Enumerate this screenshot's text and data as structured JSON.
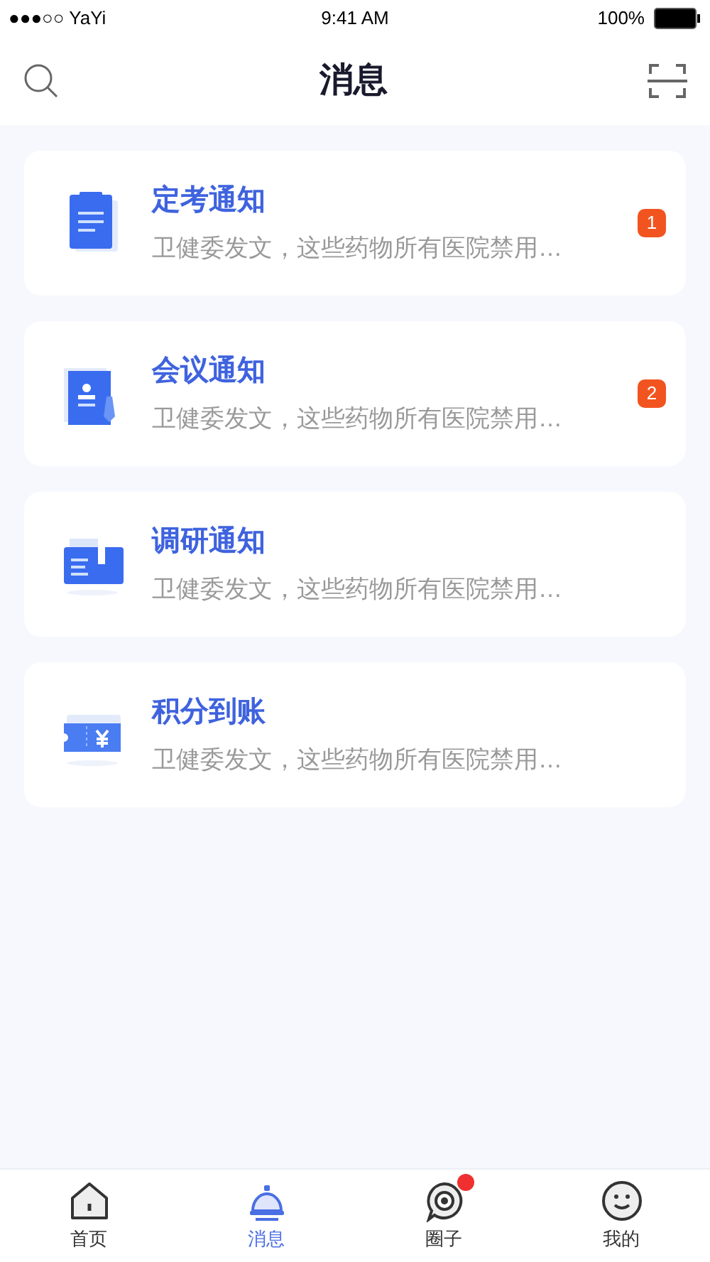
{
  "status_bar": {
    "carrier": "●●●○○ YaYi",
    "time": "9:41 AM",
    "battery": "100%"
  },
  "header": {
    "title": "消息"
  },
  "messages": [
    {
      "kind": "exam",
      "title": "定考通知",
      "preview": "卫健委发文，这些药物所有医院禁用…",
      "badge": "1"
    },
    {
      "kind": "meeting",
      "title": "会议通知",
      "preview": "卫健委发文，这些药物所有医院禁用…",
      "badge": "2"
    },
    {
      "kind": "survey",
      "title": "调研通知",
      "preview": "卫健委发文，这些药物所有医院禁用…"
    },
    {
      "kind": "points",
      "title": "积分到账",
      "preview": "卫健委发文，这些药物所有医院禁用…"
    }
  ],
  "tab_bar": [
    {
      "kind": "home",
      "label": "首页",
      "selected": false,
      "dot": false
    },
    {
      "kind": "messages",
      "label": "消息",
      "selected": true,
      "dot": false
    },
    {
      "kind": "circle",
      "label": "圈子",
      "selected": false,
      "dot": true
    },
    {
      "kind": "me",
      "label": "我的",
      "selected": false,
      "dot": false
    }
  ]
}
